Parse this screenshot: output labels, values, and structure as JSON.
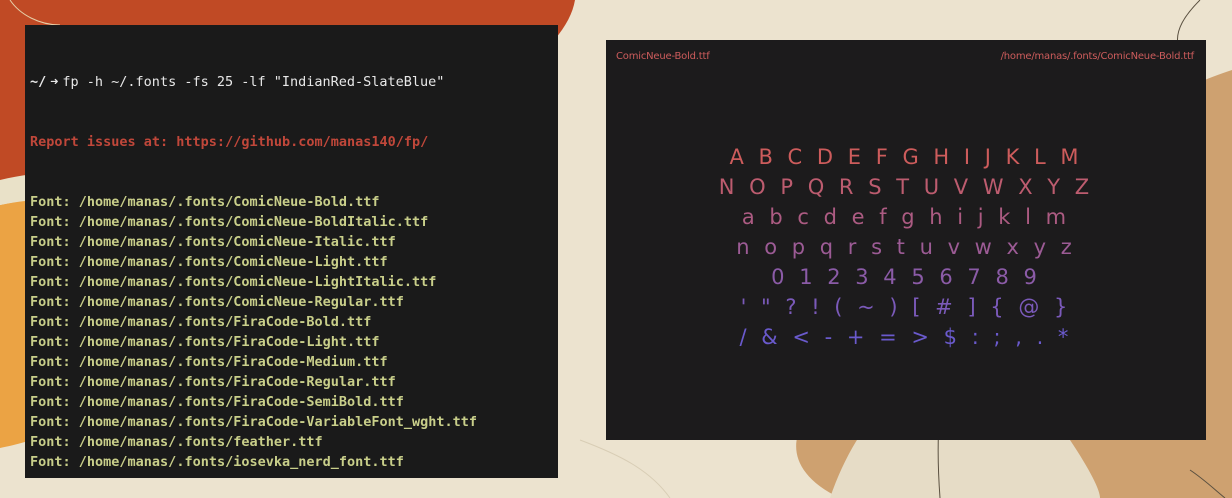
{
  "terminal": {
    "prompt": "~/",
    "prompt_symbol": "➜",
    "command": "fp -h ~/.fonts -fs 25 -lf \"IndianRed-SlateBlue\"",
    "report": "Report issues at: https://github.com/manas140/fp/",
    "font_prefix": "Font:",
    "fonts": [
      "/home/manas/.fonts/ComicNeue-Bold.ttf",
      "/home/manas/.fonts/ComicNeue-BoldItalic.ttf",
      "/home/manas/.fonts/ComicNeue-Italic.ttf",
      "/home/manas/.fonts/ComicNeue-Light.ttf",
      "/home/manas/.fonts/ComicNeue-LightItalic.ttf",
      "/home/manas/.fonts/ComicNeue-Regular.ttf",
      "/home/manas/.fonts/FiraCode-Bold.ttf",
      "/home/manas/.fonts/FiraCode-Light.ttf",
      "/home/manas/.fonts/FiraCode-Medium.ttf",
      "/home/manas/.fonts/FiraCode-Regular.ttf",
      "/home/manas/.fonts/FiraCode-SemiBold.ttf",
      "/home/manas/.fonts/FiraCode-VariableFont_wght.ttf",
      "/home/manas/.fonts/feather.ttf",
      "/home/manas/.fonts/iosevka_nerd_font.ttf"
    ]
  },
  "preview": {
    "font_name": "ComicNeue-Bold.ttf",
    "font_path": "/home/manas/.fonts/ComicNeue-Bold.ttf",
    "gradient_start_color": "#cd5c5c",
    "gradient_end_color": "#6a5acd",
    "glyph_rows": [
      "A B C D E F G H I J K L M",
      "N O P Q R S T U V W X Y Z",
      "a b c d e f g h i j k l m",
      "n o p q r s t u v w x y z",
      "0 1 2 3 4 5 6 7 8 9",
      "' \" ? ! ( ~ ) [ # ] { @ }",
      "/ & < - + = > $ : ; , . *"
    ]
  }
}
